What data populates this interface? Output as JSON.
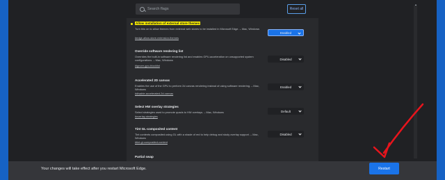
{
  "search": {
    "placeholder": "Search flags"
  },
  "reset_all": "Reset all",
  "flags": [
    {
      "title": "Allow installation of external store themes",
      "description": "Turn this on to allow themes from external web stores to be installed in Microsoft Edge. – Mac, Windows",
      "link": "#edge-allow-store-extension-themes",
      "value": "Enabled"
    },
    {
      "title": "Override software rendering list",
      "description": "Overrides the built-in software rendering list and enables GPU-acceleration on unsupported system configurations. – Mac, Windows",
      "link": "#ignore-gpu-blocklist",
      "value": "Disabled"
    },
    {
      "title": "Accelerated 2D canvas",
      "description": "Enables the use of the GPU to perform 2d canvas rendering instead of using software rendering. – Mac, Windows",
      "link": "#disable-accelerated-2d-canvas",
      "value": "Enabled"
    },
    {
      "title": "Select HW overlay strategies",
      "description": "Select strategies used to promote quads to HW overlays. – Mac, Windows",
      "link": "#overlay-strategies",
      "value": "Default"
    },
    {
      "title": "Tint GL-composited content",
      "description": "Tint contents composited using GL with a shade of red to help debug and study overlay support. – Mac, Windows",
      "link": "#tint-gl-composited-content",
      "value": "Disabled"
    },
    {
      "title": "Partial swap",
      "description": "",
      "link": "",
      "value": ""
    }
  ],
  "bottom_bar": {
    "message": "Your changes will take effect after you restart Microsoft Edge.",
    "restart_label": "Restart"
  },
  "colors": {
    "accent": "#1a73e8",
    "highlight": "#fff200",
    "arrow": "#e8141c",
    "frame": "#1662c4"
  }
}
